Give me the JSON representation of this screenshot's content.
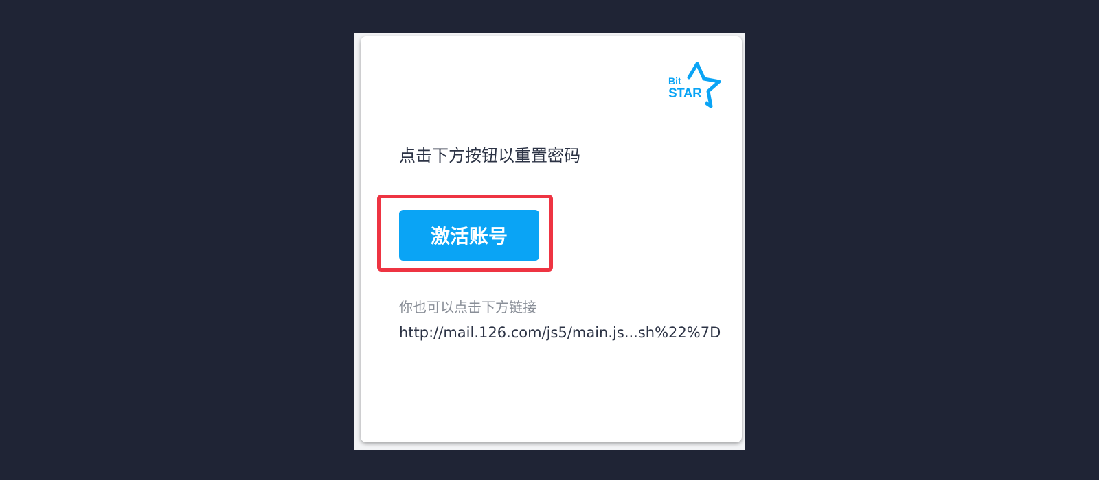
{
  "logo": {
    "line1": "Bit",
    "line2": "STAR",
    "color": "#0aa4f5"
  },
  "email": {
    "headline": "点击下方按钮以重置密码",
    "button_label": "激活账号",
    "alt_text": "你也可以点击下方链接",
    "link_text": "http://mail.126.com/js5/main.js...sh%22%7D"
  },
  "colors": {
    "background": "#1f2435",
    "accent": "#0aa4f5",
    "highlight": "#ee3442",
    "text": "#2c3345",
    "muted_text": "#8a8f98"
  }
}
